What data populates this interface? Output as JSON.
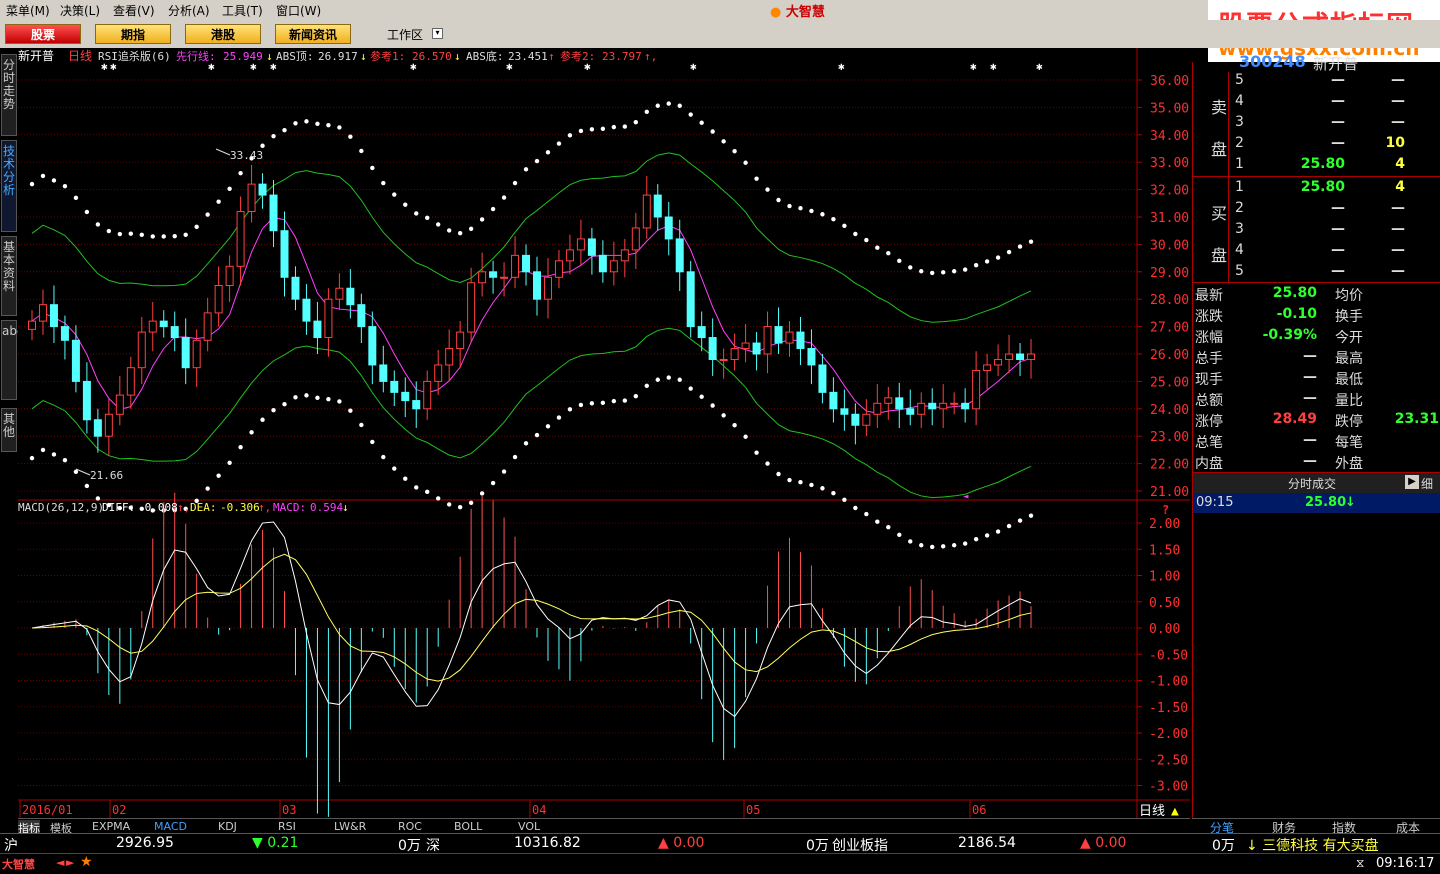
{
  "menu": [
    "菜单(M)",
    "决策(L)",
    "查看(V)",
    "分析(A)",
    "工具(T)",
    "窗口(W)"
  ],
  "app_logo": "大智慧",
  "brand": {
    "title": "股票公式指标网",
    "url": "www.gsxx.com.cn"
  },
  "nav_buttons": [
    "股票",
    "期指",
    "港股",
    "新闻资讯"
  ],
  "workzone": "工作区",
  "left_tabs": [
    "分时走势",
    "技术分析",
    "基本资料",
    "abcd",
    "其他"
  ],
  "stock": {
    "name": "新开普",
    "code": "300248",
    "period": "日线"
  },
  "top_info": {
    "formula": "RSI追杀版(6)",
    "lead_label": "先行线:",
    "lead_value": "25.949",
    "abs_top_label": "ABS顶:",
    "abs_top_value": "26.917",
    "ref1_label": "参考1:",
    "ref1_value": "26.570",
    "abs_bottom_label": "ABS底:",
    "abs_bottom_value": "23.451",
    "ref2_label": "参考2:",
    "ref2_value": "23.797"
  },
  "price_axis": [
    "36.00",
    "35.00",
    "34.00",
    "33.00",
    "32.00",
    "31.00",
    "30.00",
    "29.00",
    "28.00",
    "27.00",
    "26.00",
    "25.00",
    "24.00",
    "23.00",
    "22.00",
    "21.00"
  ],
  "annotations": {
    "high": "33.43",
    "low": "21.66"
  },
  "macd_info": {
    "title": "MACD(26,12,9)",
    "diff_label": "DIFF:",
    "diff_value": "-0.008",
    "dea_label": "DEA:",
    "dea_value": "-0.306",
    "macd_label": "MACD:",
    "macd_value": "0.594"
  },
  "macd_axis": [
    "2.00",
    "1.50",
    "1.00",
    "0.50",
    "0.00",
    "-0.50",
    "-1.00",
    "-1.50",
    "-2.00",
    "-2.50",
    "-3.00"
  ],
  "date_labels": [
    "2016/01",
    "02",
    "03",
    "04",
    "05",
    "06"
  ],
  "period_label": "日线",
  "orderbook": {
    "sell_label": [
      "卖",
      "盘"
    ],
    "buy_label": [
      "买",
      "盘"
    ],
    "sell": [
      {
        "level": "5",
        "price": "—",
        "vol": "—"
      },
      {
        "level": "4",
        "price": "—",
        "vol": "—"
      },
      {
        "level": "3",
        "price": "—",
        "vol": "—"
      },
      {
        "level": "2",
        "price": "—",
        "vol": "10"
      },
      {
        "level": "1",
        "price": "25.80",
        "vol": "4"
      }
    ],
    "buy": [
      {
        "level": "1",
        "price": "25.80",
        "vol": "4"
      },
      {
        "level": "2",
        "price": "—",
        "vol": "—"
      },
      {
        "level": "3",
        "price": "—",
        "vol": "—"
      },
      {
        "level": "4",
        "price": "—",
        "vol": "—"
      },
      {
        "level": "5",
        "price": "—",
        "vol": "—"
      }
    ]
  },
  "quote": [
    {
      "l": "最新",
      "v": "25.80",
      "l2": "均价",
      "v2": ""
    },
    {
      "l": "涨跌",
      "v": "-0.10",
      "l2": "换手",
      "v2": ""
    },
    {
      "l": "涨幅",
      "v": "-0.39%",
      "l2": "今开",
      "v2": ""
    },
    {
      "l": "总手",
      "v": "—",
      "l2": "最高",
      "v2": ""
    },
    {
      "l": "现手",
      "v": "—",
      "l2": "最低",
      "v2": ""
    },
    {
      "l": "总额",
      "v": "—",
      "l2": "量比",
      "v2": ""
    },
    {
      "l": "涨停",
      "v": "28.49",
      "l2": "跌停",
      "v2": "23.31"
    },
    {
      "l": "总笔",
      "v": "—",
      "l2": "每笔",
      "v2": ""
    },
    {
      "l": "内盘",
      "v": "—",
      "l2": "外盘",
      "v2": ""
    }
  ],
  "trade_header": "分时成交",
  "trade_btn": "细",
  "trades": [
    {
      "time": "09:15",
      "price": "25.80",
      "dir": "↓"
    }
  ],
  "right_tabs": [
    "分笔",
    "财务",
    "指数",
    "成本"
  ],
  "indicator_tabs": [
    "指标",
    "模板",
    "EXPMA",
    "MACD",
    "KDJ",
    "RSI",
    "LW&R",
    "ROC",
    "BOLL",
    "VOL"
  ],
  "status": {
    "sh_label": "沪",
    "sh_index": "2926.95",
    "sh_change": "▼ 0.21",
    "sh_vol": "0万",
    "sz_label": "深",
    "sz_index": "10316.82",
    "sz_change": "▲ 0.00",
    "sz_vol": "0万",
    "cy_label": "创业板指",
    "cy_index": "2186.54",
    "cy_change": "▲ 0.00",
    "cy_vol": "0万",
    "news": "↓ 三德科技 有大买盘"
  },
  "clock": "09:16:17",
  "colors": {
    "up": "#ff4040",
    "down": "#54ffff",
    "ma": "#ff40ff",
    "band": "#20c020"
  }
}
